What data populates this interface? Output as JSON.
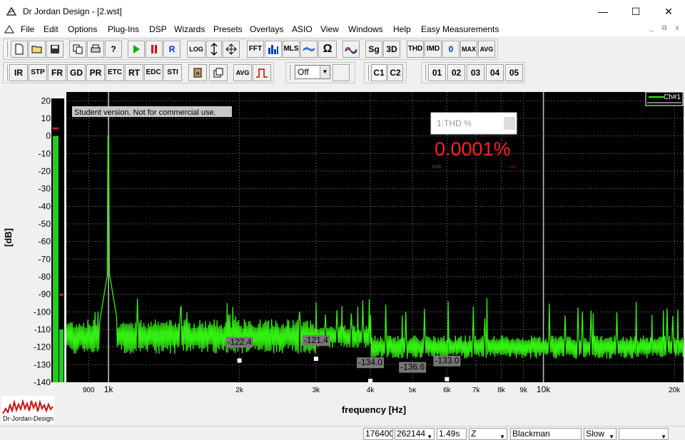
{
  "window": {
    "title": "Dr Jordan Design - [2.wst]",
    "minimize": "—",
    "maximize": "☐",
    "close": "✕"
  },
  "menu": {
    "items": [
      "File",
      "Edit",
      "Options",
      "Plug-Ins",
      "DSP",
      "Wizards",
      "Presets",
      "Overlays",
      "ASIO",
      "View",
      "Windows",
      "Help",
      "Easy Measurements"
    ],
    "mdi": [
      "_",
      "⧉",
      "x"
    ]
  },
  "toolbar1": {
    "icons": [
      "new-file-icon",
      "open-folder-icon",
      "save-icon",
      "copy-icon",
      "print-icon",
      "help-icon",
      "play-icon",
      "pause-icon",
      "r-icon",
      "log-icon",
      "vertical-arrow-icon",
      "move-arrows-icon",
      "fft-icon",
      "bars-icon",
      "mls-icon",
      "af-icon",
      "omega-icon",
      "sine-icon",
      "sg-icon",
      "3d-icon",
      "thd-icon",
      "imd-icon",
      "zero-icon",
      "max-icon",
      "avg-icon"
    ],
    "labels": {
      "r": "R",
      "log": "LOG",
      "fft": "FFT",
      "mls": "MLS",
      "sg": "Sg",
      "d3": "3D",
      "thd": "THD",
      "imd": "IMD",
      "zero": "0",
      "max": "MAX",
      "avg": "AVG",
      "omega": "Ω",
      "help": "?"
    }
  },
  "toolbar2": {
    "buttons": [
      "IR",
      "STP",
      "FR",
      "GD",
      "PR",
      "ETC",
      "RT",
      "EDC",
      "STI"
    ],
    "avg_label": "AVG",
    "dropdown_value": "Off",
    "channels": [
      "C1",
      "C2"
    ],
    "slots": [
      "01",
      "02",
      "03",
      "04",
      "05"
    ]
  },
  "watermark": "Student version. Not for commercial use.",
  "thd_panel": {
    "title": "1:THD %",
    "value": "0.0001%",
    "min_label": "0.00",
    "color": "#ff2020"
  },
  "legend": {
    "label": "Ch#1"
  },
  "chart_data": {
    "type": "line",
    "xlabel": "frequency [Hz]",
    "ylabel": "[dB]",
    "x_scale": "log",
    "xlim": [
      800,
      21000
    ],
    "ylim": [
      -140,
      25
    ],
    "x_ticks": [
      {
        "v": 900,
        "l": "900",
        "minor": true
      },
      {
        "v": 1000,
        "l": "1k",
        "minor": false
      },
      {
        "v": 2000,
        "l": "2k",
        "minor": true
      },
      {
        "v": 3000,
        "l": "3k",
        "minor": true
      },
      {
        "v": 4000,
        "l": "4k",
        "minor": true
      },
      {
        "v": 5000,
        "l": "5k",
        "minor": true
      },
      {
        "v": 6000,
        "l": "6k",
        "minor": true
      },
      {
        "v": 7000,
        "l": "7k",
        "minor": true
      },
      {
        "v": 8000,
        "l": "8k",
        "minor": true
      },
      {
        "v": 9000,
        "l": "9k",
        "minor": true
      },
      {
        "v": 10000,
        "l": "10k",
        "minor": false
      },
      {
        "v": 20000,
        "l": "20k",
        "minor": true
      }
    ],
    "y_ticks": [
      20,
      10,
      0,
      -10,
      -20,
      -30,
      -40,
      -50,
      -60,
      -70,
      -80,
      -90,
      -100,
      -110,
      -120,
      -130,
      -140
    ],
    "series": [
      {
        "name": "Ch#1",
        "color": "#33ee11",
        "peaks": [
          [
            1000,
            0
          ],
          [
            2000,
            -122.4
          ],
          [
            3000,
            -121.4
          ],
          [
            4000,
            -134.0
          ],
          [
            5000,
            -136.6
          ],
          [
            6000,
            -133.0
          ]
        ],
        "noise_floor_db": -112
      }
    ],
    "markers": [
      {
        "f": 2000,
        "label": "-122.4"
      },
      {
        "f": 3000,
        "label": "-121.4"
      },
      {
        "f": 4000,
        "label": "-134.0"
      },
      {
        "f": 5000,
        "label": "-136.6"
      },
      {
        "f": 6000,
        "label": "-133.0"
      }
    ],
    "grid": true,
    "legend_position": "top-right",
    "background": "#000000"
  },
  "level_meter": {
    "level_db": -110,
    "peak_db": -90,
    "top_db": 0
  },
  "logo": {
    "text": "Dr-Jordan-Design"
  },
  "status": {
    "sample_rate": "176400",
    "fft_size": "262144",
    "time": "1.49s",
    "weighting": "Z",
    "window": "Blackman",
    "speed": "Slow",
    "extra": ""
  }
}
